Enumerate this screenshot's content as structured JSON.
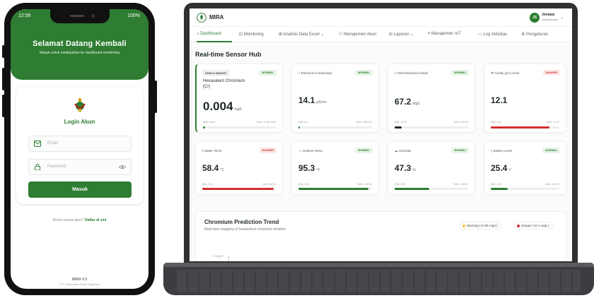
{
  "phone": {
    "status_time": "12:56",
    "status_battery": "100%",
    "welcome_title": "Selamat Datang Kembali",
    "welcome_subtitle": "Masuk untuk melanjutkan ke dashboard monitoring",
    "login_title": "Login Akun",
    "email_placeholder": "Email",
    "password_placeholder": "Password",
    "submit_label": "Masuk",
    "register_prompt": "Belum punya akun?",
    "register_link": "Daftar di sini",
    "version": "MIRA V.3",
    "copyright": "© PT Meteranta Prima Sejahtera"
  },
  "dashboard": {
    "brand": "MIRA",
    "user": {
      "initials": "JS",
      "name": "Jimakai",
      "role": "Administrator"
    },
    "nav": [
      {
        "label": "Dashboard",
        "active": true
      },
      {
        "label": "Monitoring"
      },
      {
        "label": "Analisis Data Excel ⌄"
      },
      {
        "label": "Manajemen Akun"
      },
      {
        "label": "Laporan ⌄"
      },
      {
        "label": "Manajemen IoT"
      },
      {
        "label": "Log Aktivitas"
      },
      {
        "label": "Pengaturan"
      }
    ],
    "section_title": "Real-time Sensor Hub",
    "sensors": [
      {
        "tag": "HOW A INSIGHT",
        "label": "Hexavalent Chromium (Cr)",
        "status": "NORMAL",
        "value": "0.004",
        "unit": "mg/L",
        "min": "MIN: 0.000",
        "max": "MAX: 0.050 Limit",
        "level": 0.03,
        "bar_color": "#2e7d32"
      },
      {
        "label": "Electrical Conductivity",
        "status": "NORMAL",
        "value": "14.1",
        "unit": "µS/cm",
        "min": "MIN: 0.0",
        "max": "MAX: 1000.00",
        "level": 0.02,
        "bar_color": "#2e7d32"
      },
      {
        "label": "Total Dissolved Solids",
        "status": "NORMAL",
        "value": "67.2",
        "unit": "mg/L",
        "min": "MIN: 15.00",
        "max": "MAX: 500.00",
        "level": 0.1,
        "bar_color": "#1f2a24"
      },
      {
        "label": "Acidity (pH Level)",
        "status": "DANGER",
        "value": "12.1",
        "unit": "",
        "min": "MIN: 0.00",
        "max": "MAX: 14.00",
        "level": 0.86,
        "bar_color": "#d32f2f"
      },
      {
        "label": "Water Temp",
        "status": "DANGER",
        "value": "58.4",
        "unit": "°C",
        "min": "MIN: 0.00",
        "max": "MAX: 60.00",
        "level": 0.97,
        "bar_color": "#d32f2f"
      },
      {
        "label": "Ambient Temp",
        "status": "NORMAL",
        "value": "95.3",
        "unit": "°F",
        "min": "MIN: 0.00",
        "max": "MAX: 100.00",
        "level": 0.95,
        "bar_color": "#2e7d32"
      },
      {
        "label": "Humidity",
        "status": "NORMAL",
        "value": "47.3",
        "unit": "%",
        "min": "MIN: 0.00",
        "max": "MAX: 100.00",
        "level": 0.47,
        "bar_color": "#2e7d32"
      },
      {
        "label": "Battery Level",
        "status": "NORMAL",
        "value": "25.4",
        "unit": "V",
        "min": "MIN: 0.00",
        "max": "MAX: 100.00",
        "level": 0.25,
        "bar_color": "#2e7d32"
      }
    ],
    "trend": {
      "title": "Chromium Prediction Trend",
      "subtitle": "Real-time mapping of hexavalent chromium timeline",
      "legend_warning": "Warning (>0.05 mg/L)",
      "legend_danger": "Danger (>0.1 mg/L)",
      "y_tick": "0.15000",
      "warning_color": "#f4c430",
      "danger_color": "#d32f2f"
    }
  }
}
